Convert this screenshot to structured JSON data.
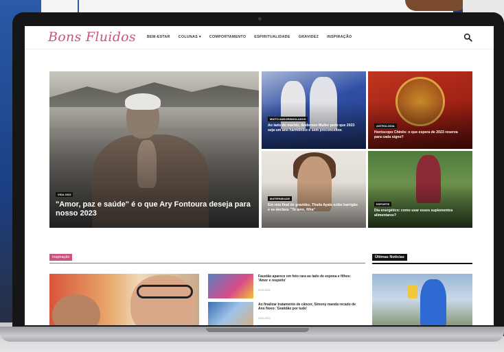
{
  "site": {
    "logo": "Bons Fluidos"
  },
  "nav": {
    "items": [
      "BEM-ESTAR",
      "COLUNAS ▾",
      "COMPORTAMENTO",
      "ESPIRITUALIDADE",
      "GRAVIDEZ",
      "INSPIRAÇÃO"
    ]
  },
  "hero": {
    "main": {
      "tag": "VIDA 2023",
      "title": "\"Amor, paz e saúde\" é o que Ary Fontoura deseja para nosso 2023"
    },
    "tiles": [
      {
        "tag": "MUITO ANDORINHOLADOS",
        "title": "Ao lado do marido, Anderson Muller pede que 2023 seja um ano harmônico e sem preconceitos"
      },
      {
        "tag": "ASTROLOGIA",
        "title": "Horóscopo Chinês: o que espera de 2023 reserva para cada signo?"
      },
      {
        "tag": "MATERNIDADE",
        "title": "Em reta final de gravidez, Thaila Ayala exibe barrigão e se declara: \"Te amo, filha\""
      },
      {
        "tag": "ESPORTE",
        "title": "Dia energético: como usar esses suplementos alimentares?"
      }
    ]
  },
  "inspiracao": {
    "label": "Inspiração",
    "news": [
      {
        "title": "Faustão aparece em foto rara ao lado de esposa e filhos: 'Amor e respeito'",
        "date": "02/01/2023"
      },
      {
        "title": "Ao finalizar tratamento de câncer, Simony manda recado de Ano Novo: 'Gratidão por tudo'",
        "date": "02/01/2023"
      }
    ]
  },
  "sidebar": {
    "label": "Últimas Notícias"
  },
  "colors": {
    "brand_pink": "#c8547f",
    "header_text": "#333333",
    "tag_bg": "#111111"
  },
  "icons": {
    "search": "search-icon"
  }
}
